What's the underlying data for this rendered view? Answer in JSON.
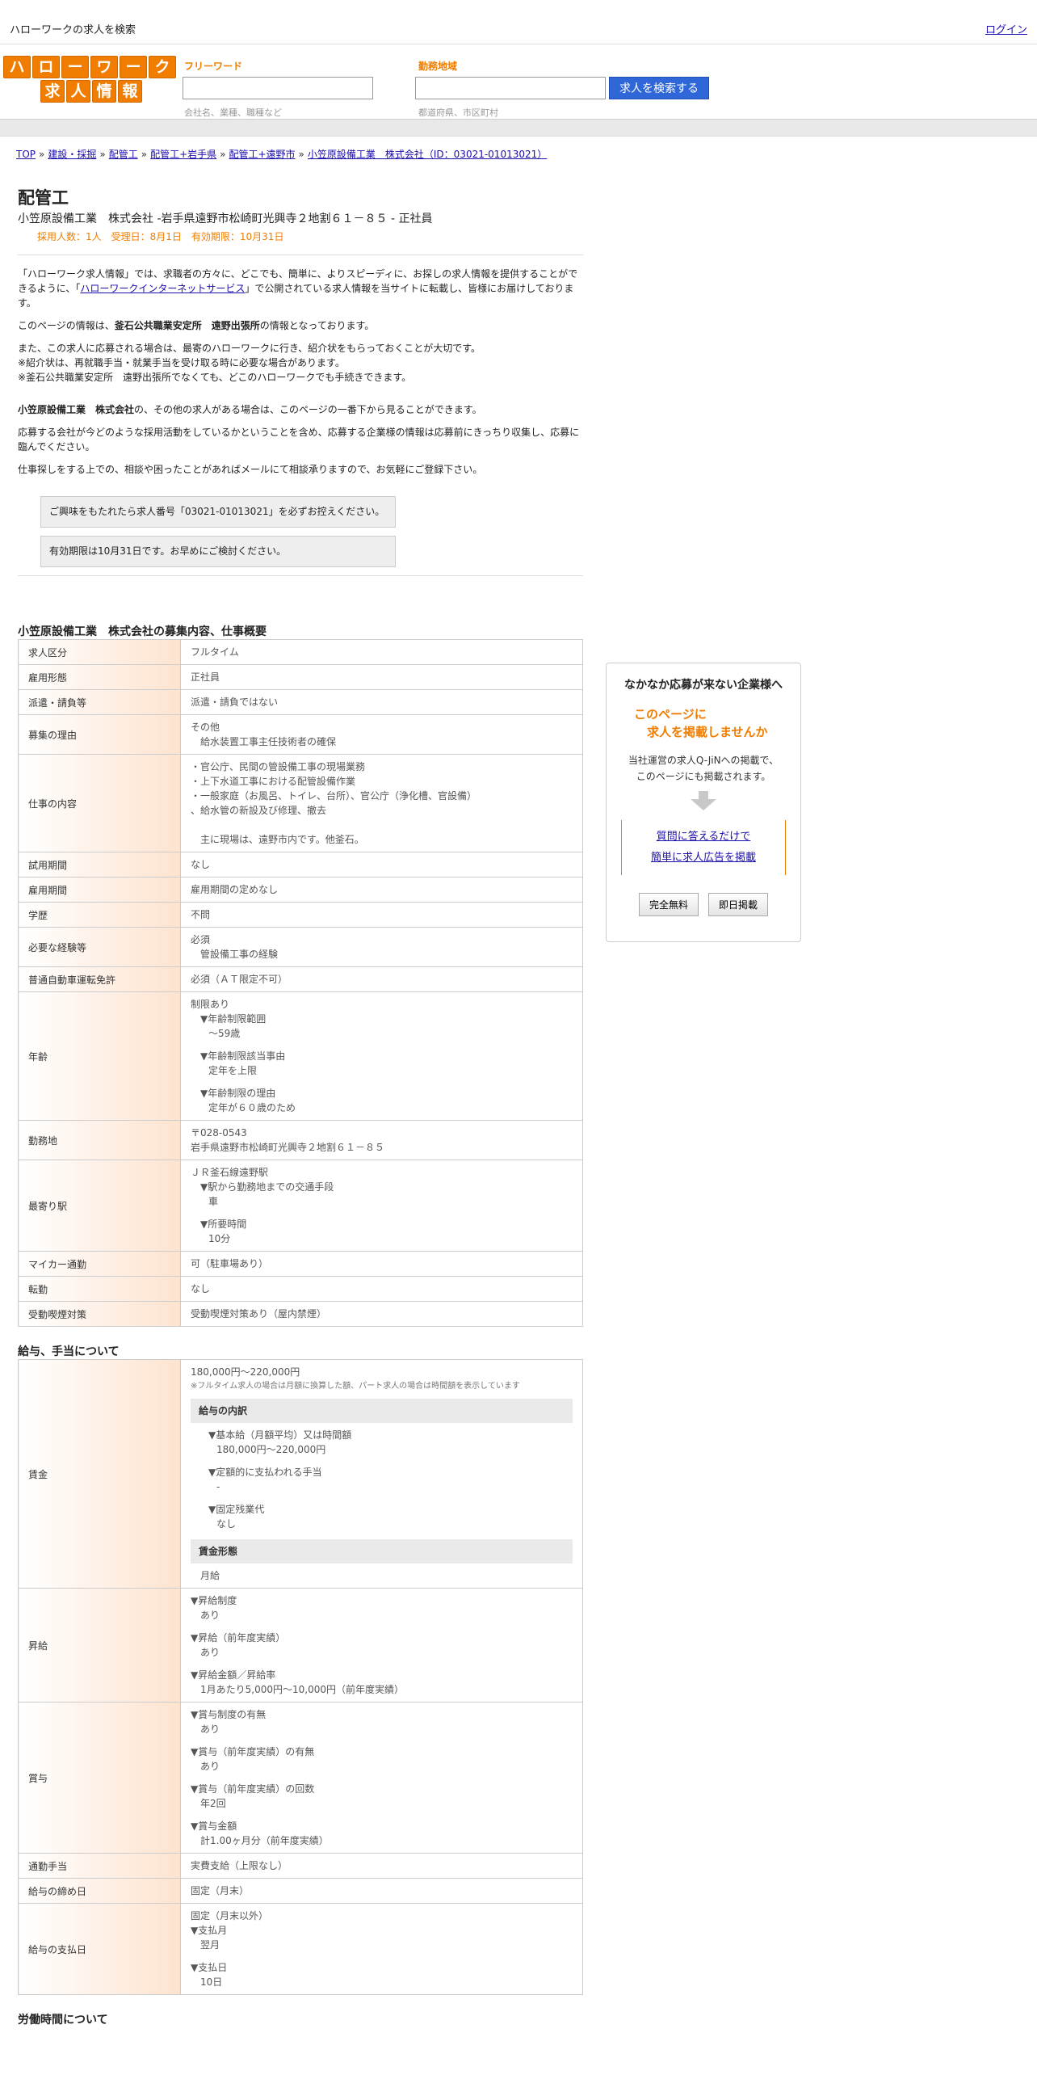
{
  "topbar": {
    "site_title": "ハローワークの求人を検索",
    "login": "ログイン"
  },
  "logo": {
    "row1": [
      "ハ",
      "ロ",
      "ー",
      "ワ",
      "ー",
      "ク"
    ],
    "row2": [
      "求",
      "人",
      "情",
      "報"
    ]
  },
  "search": {
    "keyword_label": "フリーワード",
    "keyword_hint": "会社名、業種、職種など",
    "area_label": "勤務地域",
    "area_hint": "都道府県、市区町村",
    "button": "求人を検索する"
  },
  "breadcrumb": [
    "TOP",
    "建設・採掘",
    "配管工",
    "配管工+岩手県",
    "配管工+遠野市",
    "小笠原設備工業　株式会社（ID：03021-01013021）"
  ],
  "job": {
    "title": "配管工",
    "company_line": "小笠原設備工業　株式会社 -岩手県遠野市松崎町光興寺２地割６１－８５ - 正社員",
    "meta": "採用人数：1人　受理日：8月1日　有効期限：10月31日"
  },
  "intro": {
    "p1_a": "「ハローワーク求人情報」では、求職者の方々に、どこでも、簡単に、よりスピーディに、お探しの求人情報を提供することができるように、「",
    "p1_link": "ハローワークインターネットサービス",
    "p1_b": "」で公開されている求人情報を当サイトに転載し、皆様にお届けしております。",
    "p2_a": "このページの情報は、",
    "p2_bold": "釜石公共職業安定所　遠野出張所",
    "p2_b": "の情報となっております。",
    "p3_1": "また、この求人に応募される場合は、最寄のハローワークに行き、紹介状をもらっておくことが大切です。",
    "p3_2": "※紹介状は、再就職手当・就業手当を受け取る時に必要な場合があります。",
    "p3_3": "※釜石公共職業安定所　遠野出張所でなくても、どこのハローワークでも手続きできます。",
    "p4_bold": "小笠原設備工業　株式会社",
    "p4_b": "の、その他の求人がある場合は、このページの一番下から見ることができます。",
    "p5": "応募する会社が今どのような採用活動をしているかということを含め、応募する企業様の情報は応募前にきっちり収集し、応募に臨んでください。",
    "p6": "仕事探しをする上での、相談や困ったことがあればメールにて相談承りますので、お気軽にご登録下さい。",
    "box1": "ご興味をもたれたら求人番号「03021-01013021」を必ずお控えください。",
    "box2": "有効期限は10月31日です。お早めにご検討ください。"
  },
  "section1": {
    "title": "小笠原設備工業　株式会社の募集内容、仕事概要",
    "rows": {
      "kubun": [
        "求人区分",
        "フルタイム"
      ],
      "keitai": [
        "雇用形態",
        "正社員"
      ],
      "haken": [
        "派遣・請負等",
        "派遣・請負ではない"
      ],
      "riyuu": [
        "募集の理由",
        "その他",
        "給水装置工事主任技術者の確保"
      ],
      "naiyou": [
        "仕事の内容",
        "・官公庁、民間の管設備工事の現場業務",
        "・上下水道工事における配管設備作業",
        "・一般家庭（お風呂、トイレ、台所）、官公庁（浄化槽、官設備）",
        "、給水管の新設及び修理、撤去",
        "主に現場は、遠野市内です。他釜石。"
      ],
      "shiyou": [
        "試用期間",
        "なし"
      ],
      "kikan": [
        "雇用期間",
        "雇用期間の定めなし"
      ],
      "gakureki": [
        "学歴",
        "不問"
      ],
      "keiken": [
        "必要な経験等",
        "必須",
        "管設備工事の経験"
      ],
      "menkyo": [
        "普通自動車運転免許",
        "必須（ＡＴ限定不可）"
      ],
      "nenrei": [
        "年齢",
        "制限あり",
        "▼年齢制限範囲",
        "〜59歳",
        "▼年齢制限該当事由",
        "定年を上限",
        "▼年齢制限の理由",
        "定年が６０歳のため"
      ],
      "kinmuchi": [
        "勤務地",
        "〒028-0543",
        "岩手県遠野市松崎町光興寺２地割６１－８５"
      ],
      "moyori": [
        "最寄り駅",
        "ＪＲ釜石線遠野駅",
        "▼駅から勤務地までの交通手段",
        "車",
        "▼所要時間",
        "10分"
      ],
      "mycar": [
        "マイカー通勤",
        "可（駐車場あり）"
      ],
      "tenkin": [
        "転勤",
        "なし"
      ],
      "kitsuen": [
        "受動喫煙対策",
        "受動喫煙対策あり（屋内禁煙）"
      ]
    }
  },
  "section2": {
    "title": "給与、手当について",
    "chingin": {
      "label": "賃金",
      "range": "180,000円〜220,000円",
      "note": "※フルタイム求人の場合は月額に換算した額、パート求人の場合は時間額を表示しています",
      "breakdown_head": "給与の内訳",
      "b1": "▼基本給（月額平均）又は時間額",
      "b1v": "180,000円〜220,000円",
      "b2": "▼定額的に支払われる手当",
      "b2v": "-",
      "b3": "▼固定残業代",
      "b3v": "なし",
      "form_head": "賃金形態",
      "form": "月給"
    },
    "shoukyu": {
      "label": "昇給",
      "a": "▼昇給制度",
      "av": "あり",
      "b": "▼昇給（前年度実績）",
      "bv": "あり",
      "c": "▼昇給金額／昇給率",
      "cv": "1月あたり5,000円〜10,000円（前年度実績）"
    },
    "shouyo": {
      "label": "賞与",
      "a": "▼賞与制度の有無",
      "av": "あり",
      "b": "▼賞与（前年度実績）の有無",
      "bv": "あり",
      "c": "▼賞与（前年度実績）の回数",
      "cv": "年2回",
      "d": "▼賞与金額",
      "dv": "計1.00ヶ月分（前年度実績）"
    },
    "tsukin": [
      "通勤手当",
      "実費支給（上限なし）"
    ],
    "shime": [
      "給与の締め日",
      "固定（月末）"
    ],
    "shiharai": [
      "給与の支払日",
      "固定（月末以外）",
      "▼支払月",
      "翌月",
      "▼支払日",
      "10日"
    ]
  },
  "section3": {
    "title": "労働時間について"
  },
  "side": {
    "title": "なかなか応募が来ない企業様へ",
    "orange1": "このページに",
    "orange2": "求人を掲載しませんか",
    "text1": "当社運営の求人Q-JiNへの掲載で、",
    "text2": "このページにも掲載されます。",
    "link1": "質問に答えるだけで",
    "link2": "簡単に求人広告を掲載",
    "btn1": "完全無料",
    "btn2": "即日掲載"
  }
}
